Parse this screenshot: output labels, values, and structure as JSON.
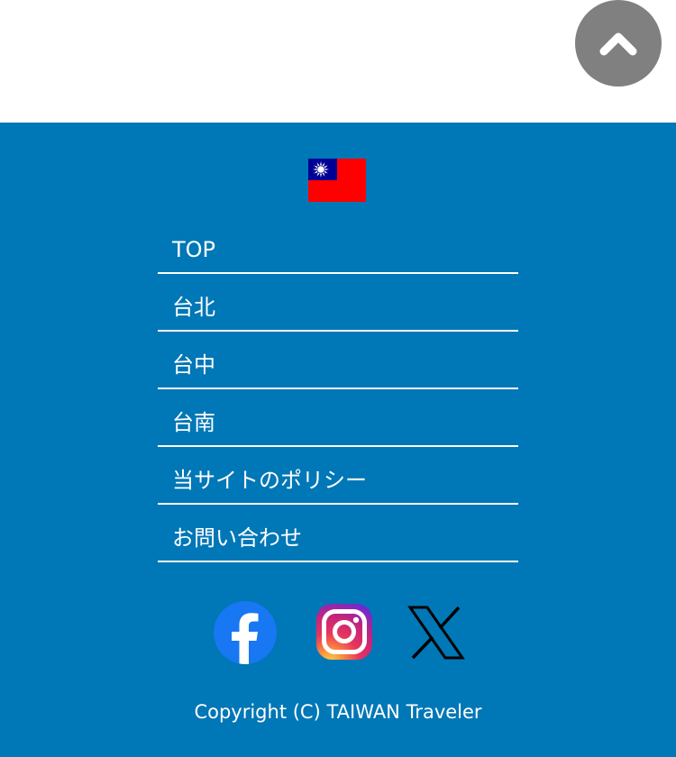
{
  "back_to_top": {
    "icon": "chevron-up-icon",
    "color": "#808080"
  },
  "footer": {
    "background": "#0077b6",
    "flag_icon": "taiwan-flag-icon",
    "nav": [
      {
        "label": "TOP"
      },
      {
        "label": "台北"
      },
      {
        "label": "台中"
      },
      {
        "label": "台南"
      },
      {
        "label": "当サイトのポリシー"
      },
      {
        "label": "お問い合わせ"
      }
    ],
    "social": [
      {
        "icon": "facebook-icon"
      },
      {
        "icon": "instagram-icon"
      },
      {
        "icon": "x-icon"
      }
    ],
    "copyright": "Copyright (C) TAIWAN Traveler"
  }
}
